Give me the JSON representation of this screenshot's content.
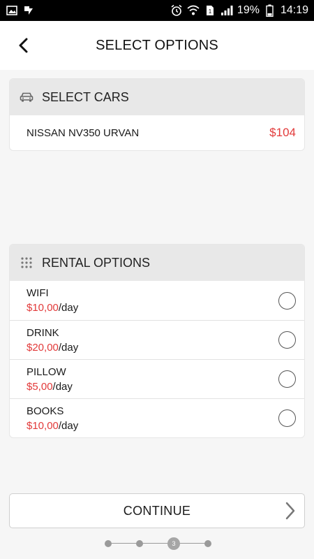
{
  "status_bar": {
    "battery_percent": "19%",
    "time": "14:19"
  },
  "header": {
    "title": "SELECT OPTIONS"
  },
  "cars_section": {
    "title": "SELECT CARS",
    "items": [
      {
        "name": "NISSAN NV350 URVAN",
        "price": "$104"
      }
    ]
  },
  "rental_options": {
    "title": "RENTAL OPTIONS",
    "items": [
      {
        "name": "WIFI",
        "price": "$10,00",
        "unit": "/day",
        "selected": false
      },
      {
        "name": "DRINK",
        "price": "$20,00",
        "unit": "/day",
        "selected": false
      },
      {
        "name": "PILLOW",
        "price": "$5,00",
        "unit": "/day",
        "selected": false
      },
      {
        "name": "BOOKS",
        "price": "$10,00",
        "unit": "/day",
        "selected": false
      }
    ]
  },
  "continue_button": {
    "label": "CONTINUE"
  },
  "stepper": {
    "steps": 4,
    "current_step": "3"
  },
  "colors": {
    "accent": "#e23a3a",
    "header_bg": "#e8e8e8"
  }
}
